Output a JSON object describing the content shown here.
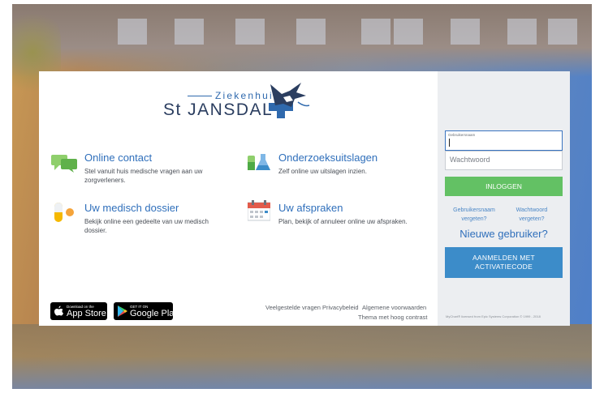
{
  "logo": {
    "top_text": "Ziekenhuis",
    "main_text": "St JANSDAL"
  },
  "features": [
    {
      "icon": "chat-bubbles-icon",
      "title": "Online contact",
      "description": "Stel vanuit huis medische vragen aan uw zorgverleners."
    },
    {
      "icon": "lab-flasks-icon",
      "title": "Onderzoeksuitslagen",
      "description": "Zelf online uw uitslagen inzien."
    },
    {
      "icon": "medicine-capsule-icon",
      "title": "Uw medisch dossier",
      "description": "Bekijk online een gedeelte van uw medisch dossier."
    },
    {
      "icon": "calendar-icon",
      "title": "Uw afspraken",
      "description": "Plan, bekijk of annuleer online uw afspraken."
    }
  ],
  "stores": {
    "appstore_small": "Download on the",
    "appstore_big": "App Store",
    "googleplay_small": "GET IT ON",
    "googleplay_big": "Google Play"
  },
  "footer": {
    "faq": "Veelgestelde vragen",
    "privacy": "Privacybeleid",
    "terms": "Algemene voorwaarden",
    "contrast": "Thema met hoog contrast"
  },
  "login": {
    "username_label": "Gebruikersnaam",
    "password_placeholder": "Wachtwoord",
    "login_button": "INLOGGEN",
    "forgot_username": "Gebruikersnaam vergeten?",
    "forgot_password": "Wachtwoord vergeten?",
    "new_user": "Nieuwe gebruiker?",
    "activate_line1": "AANMELDEN MET",
    "activate_line2": "ACTIVATIECODE",
    "copyright": "MyChart® licensed from Epic Systems Corporation © 1999 - 2018"
  },
  "colors": {
    "brand_blue": "#2f6fbb",
    "login_green": "#63c164",
    "activate_blue": "#3c8cc9"
  }
}
